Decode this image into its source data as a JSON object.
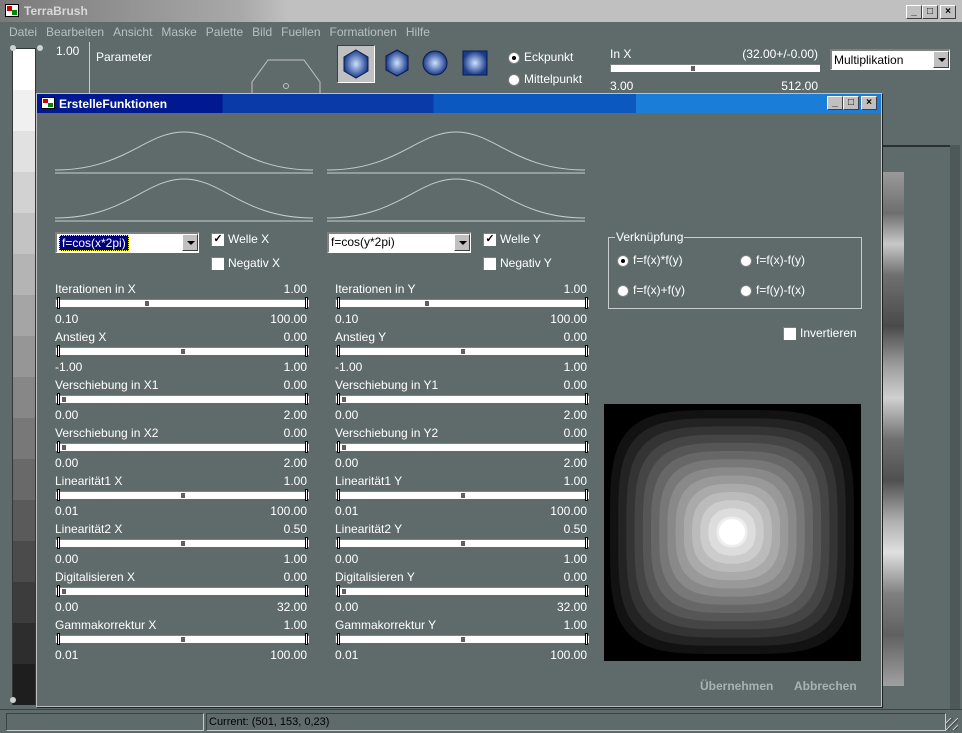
{
  "app": {
    "title": "TerraBrush",
    "menu": [
      "Datei",
      "Bearbeiten",
      "Ansicht",
      "Maske",
      "Palette",
      "Bild",
      "Fuellen",
      "Formationen",
      "Hilfe"
    ],
    "gray_scale_value": "1.00",
    "parameter_label": "Parameter",
    "eckpunkt": "Eckpunkt",
    "mittelpunkt": "Mittelpunkt",
    "in_x": {
      "label": "In X",
      "value": "(32.00+/-0.00)",
      "min": "3.00",
      "max": "512.00",
      "pos": 0.38
    },
    "blend_mode": "Multiplikation",
    "status_current": "Current: (501, 153, 0,23)"
  },
  "dialog": {
    "title": "ErstelleFunktionen",
    "x": {
      "function": "f=cos(x*2pi)",
      "welle_label": "Welle X",
      "welle_checked": true,
      "negativ_label": "Negativ X",
      "negativ_checked": false,
      "sliders": [
        {
          "label": "Iterationen in X",
          "value": "1.00",
          "min": "0.10",
          "max": "100.00",
          "pos": 0.35
        },
        {
          "label": "Anstieg X",
          "value": "0.00",
          "min": "-1.00",
          "max": "1.00",
          "pos": 0.5
        },
        {
          "label": "Verschiebung in X1",
          "value": "0.00",
          "min": "0.00",
          "max": "2.00",
          "pos": 0.0
        },
        {
          "label": "Verschiebung in X2",
          "value": "0.00",
          "min": "0.00",
          "max": "2.00",
          "pos": 0.0
        },
        {
          "label": "Linearität1 X",
          "value": "1.00",
          "min": "0.01",
          "max": "100.00",
          "pos": 0.5
        },
        {
          "label": "Linearität2 X",
          "value": "0.50",
          "min": "0.00",
          "max": "1.00",
          "pos": 0.5
        },
        {
          "label": "Digitalisieren X",
          "value": "0.00",
          "min": "0.00",
          "max": "32.00",
          "pos": 0.0
        },
        {
          "label": "Gammakorrektur X",
          "value": "1.00",
          "min": "0.01",
          "max": "100.00",
          "pos": 0.5
        }
      ]
    },
    "y": {
      "function": "f=cos(y*2pi)",
      "welle_label": "Welle Y",
      "welle_checked": true,
      "negativ_label": "Negativ Y",
      "negativ_checked": false,
      "sliders": [
        {
          "label": "Iterationen in Y",
          "value": "1.00",
          "min": "0.10",
          "max": "100.00",
          "pos": 0.35
        },
        {
          "label": "Anstieg Y",
          "value": "0.00",
          "min": "-1.00",
          "max": "1.00",
          "pos": 0.5
        },
        {
          "label": "Verschiebung in Y1",
          "value": "0.00",
          "min": "0.00",
          "max": "2.00",
          "pos": 0.0
        },
        {
          "label": "Verschiebung in Y2",
          "value": "0.00",
          "min": "0.00",
          "max": "2.00",
          "pos": 0.0
        },
        {
          "label": "Linearität1 Y",
          "value": "1.00",
          "min": "0.01",
          "max": "100.00",
          "pos": 0.5
        },
        {
          "label": "Linearität2 Y",
          "value": "0.50",
          "min": "0.00",
          "max": "1.00",
          "pos": 0.5
        },
        {
          "label": "Digitalisieren Y",
          "value": "0.00",
          "min": "0.00",
          "max": "32.00",
          "pos": 0.0
        },
        {
          "label": "Gammakorrektur Y",
          "value": "1.00",
          "min": "0.01",
          "max": "100.00",
          "pos": 0.5
        }
      ]
    },
    "verknuepfung": {
      "label": "Verknüpfung",
      "options": [
        "f=f(x)*f(y)",
        "f=f(x)-f(y)",
        "f=f(x)+f(y)",
        "f=f(y)-f(x)"
      ],
      "selected": 0
    },
    "invertieren_label": "Invertieren",
    "invertieren_checked": false,
    "apply_label": "Übernehmen",
    "cancel_label": "Abbrechen"
  }
}
